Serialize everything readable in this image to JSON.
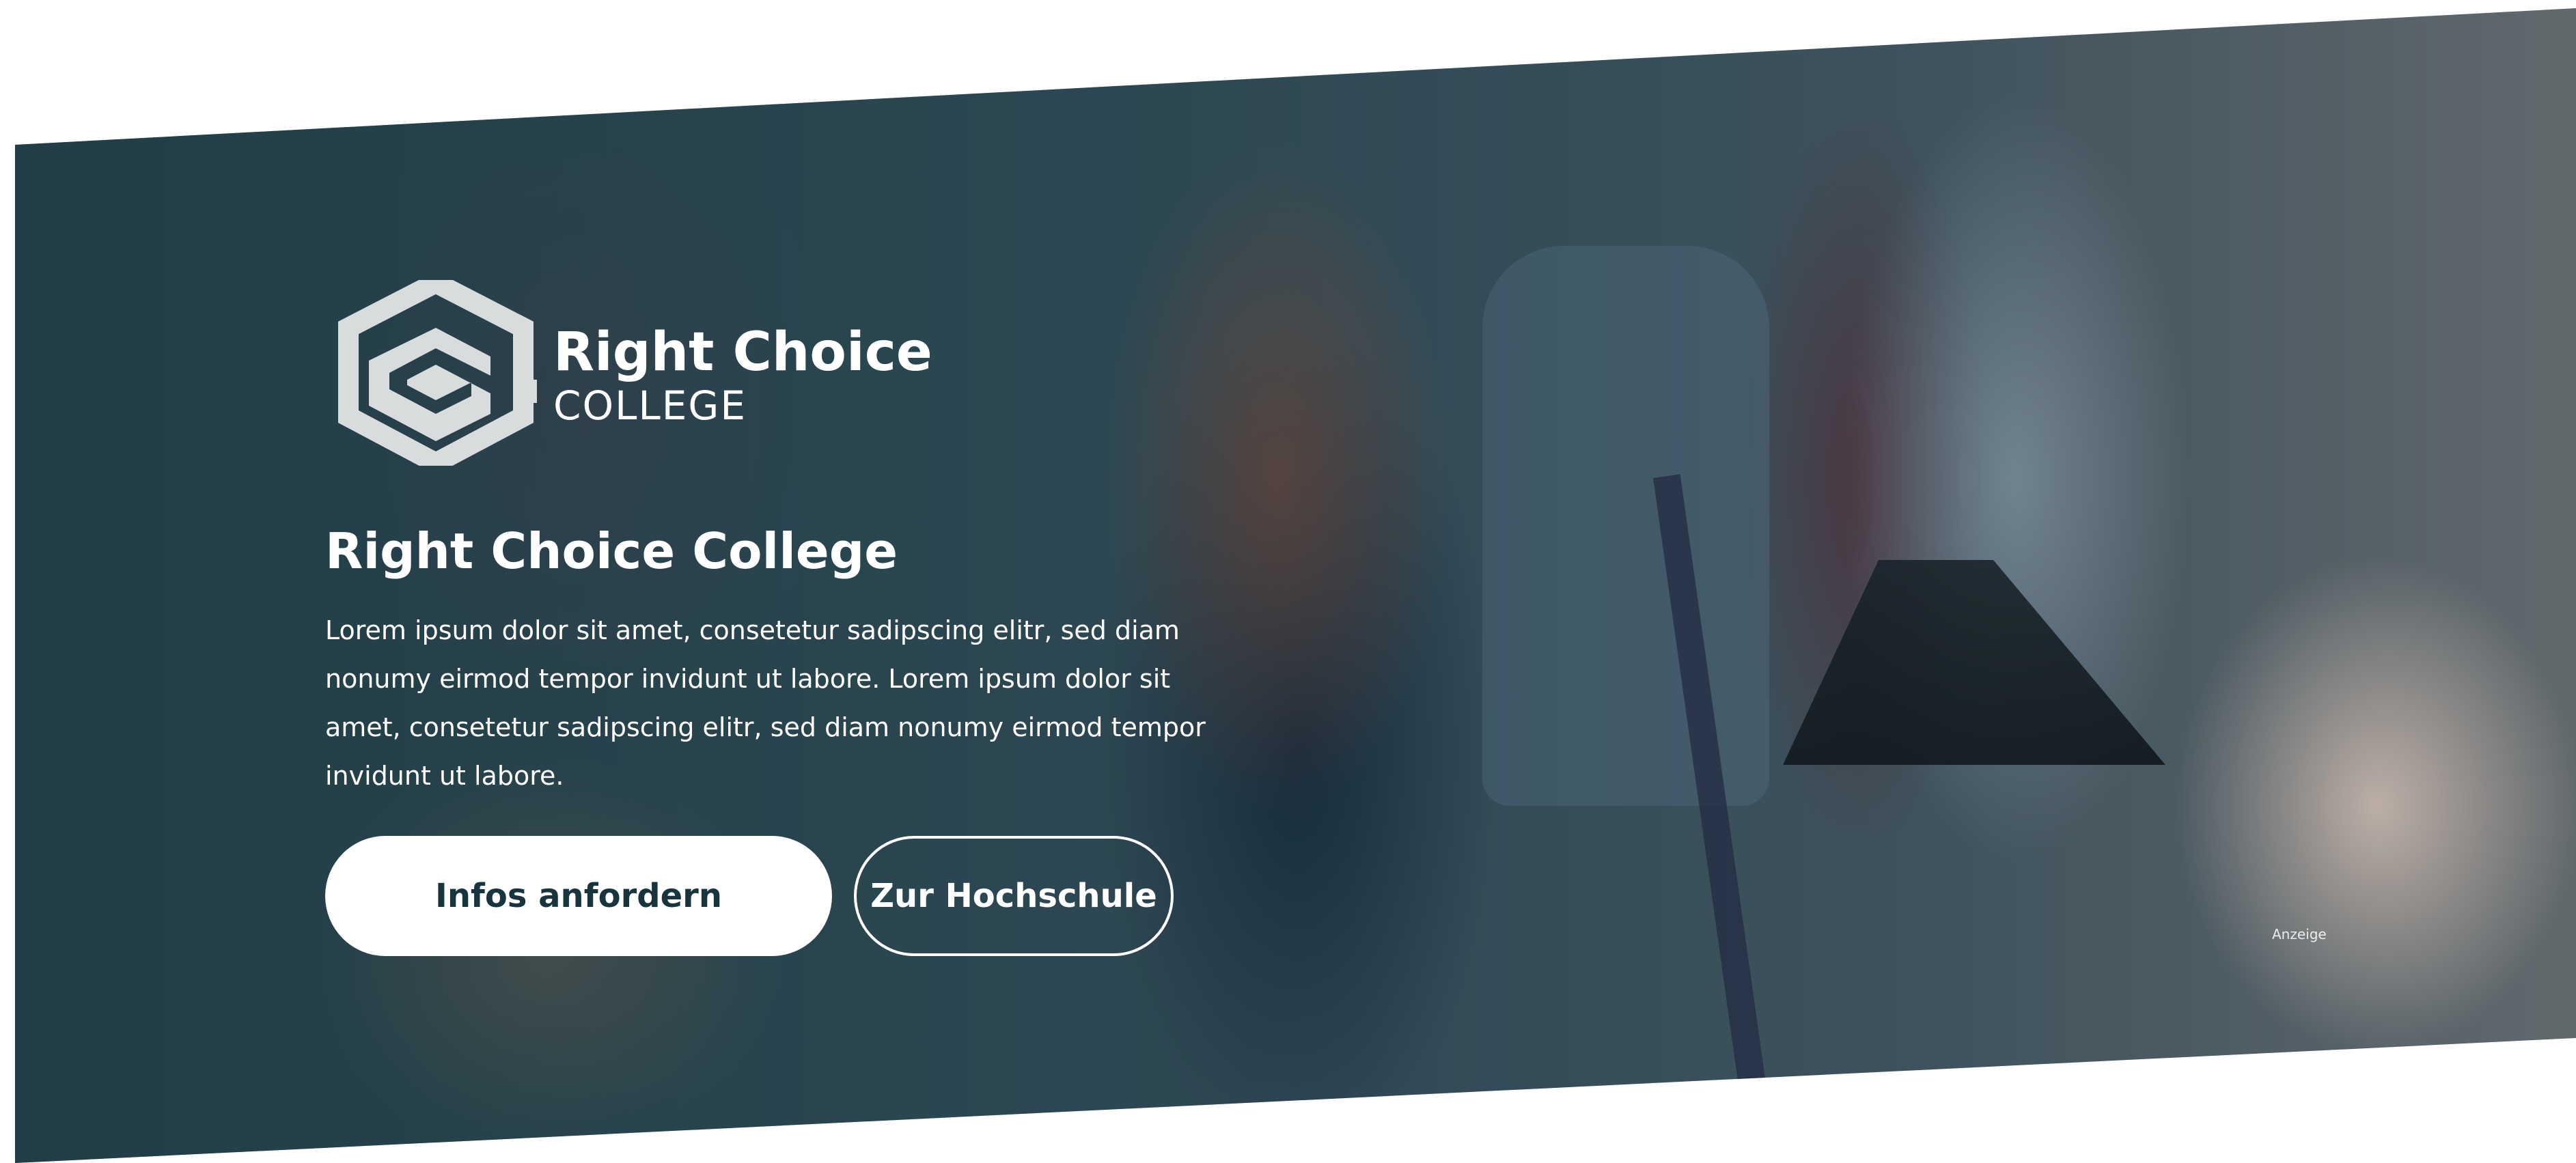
{
  "brand": {
    "name": "Right Choice",
    "subtitle": "COLLEGE"
  },
  "hero": {
    "title": "Right Choice College",
    "text": "Lorem ipsum dolor sit amet, consetetur sadipscing elitr, sed diam nonumy eirmod tempor invidunt ut labore. Lorem ipsum dolor sit amet, consetetur sadipscing elitr, sed diam nonumy eirmod tempor invidunt ut labore."
  },
  "buttons": {
    "primary_label": "Infos anfordern",
    "secondary_label": "Zur Hochschule"
  },
  "ad_label": "Anzeige",
  "colors": {
    "overlay": "#18343c",
    "button_text": "#18343c",
    "text": "#ffffff"
  },
  "icons": {
    "logo": "graduation-cap-hexagon-icon"
  }
}
